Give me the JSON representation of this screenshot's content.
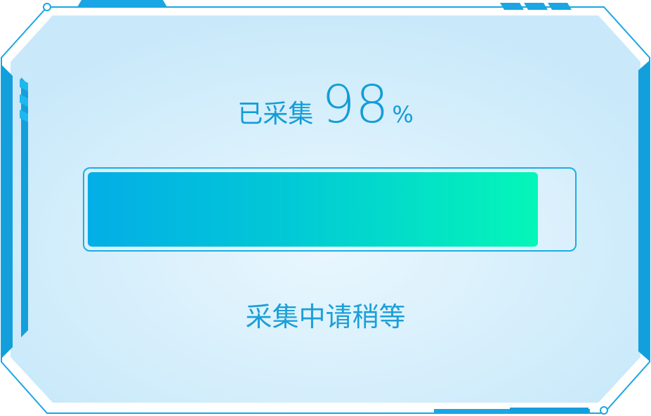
{
  "progress": {
    "label": "已采集",
    "value": "98",
    "unit": "%",
    "fraction": 0.93
  },
  "status_text": "采集中请稍等",
  "colors": {
    "accent": "#139dd6",
    "frame_stroke": "#1aa6e4",
    "panel_fill": "#d0ecfb",
    "bar_start": "#03aee6",
    "bar_end": "#04f6b8"
  }
}
